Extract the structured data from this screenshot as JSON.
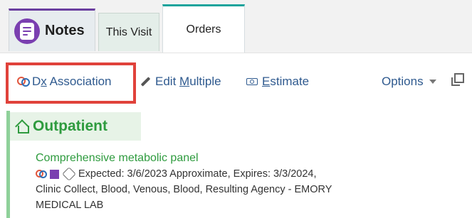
{
  "tabs": {
    "notes_label": "Notes",
    "this_visit_label": "This Visit",
    "orders_label": "Orders"
  },
  "toolbar": {
    "dx_prefix": "D",
    "dx_underlined": "x",
    "dx_suffix": " Association",
    "edit_prefix": "Edit ",
    "edit_underlined": "M",
    "edit_suffix": "ultiple",
    "estimate_underlined": "E",
    "estimate_suffix": "stimate",
    "options_label": "Options"
  },
  "main": {
    "group_title": "Outpatient",
    "order": {
      "name": "Comprehensive metabolic panel",
      "line1": "Expected: 3/6/2023 Approximate, Expires: 3/3/2024,",
      "line2": "Clinic Collect, Blood, Venous, Blood, Resulting Agency - EMORY",
      "line3": "MEDICAL LAB"
    }
  },
  "colors": {
    "notes_badge": "#7a3fb0",
    "orders_tab_accent": "#1ba39c",
    "link": "#2f5a8f",
    "highlight_box": "#e0423b",
    "outpatient_green": "#2e9b3e"
  },
  "icons": [
    "notes-icon",
    "dx-association-icon",
    "pencil-icon",
    "estimate-icon",
    "caret-down-icon",
    "popout-icon",
    "home-icon",
    "purple-square-icon",
    "cube-icon"
  ]
}
